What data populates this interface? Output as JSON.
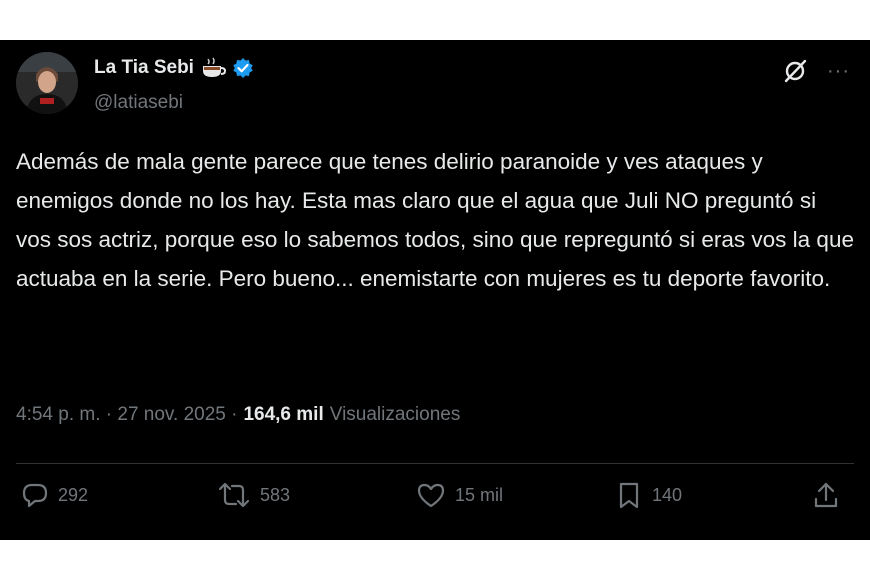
{
  "author": {
    "name": "La Tia Sebi",
    "emoji": "☕",
    "handle": "@latiasebi"
  },
  "tweet": {
    "text": "Además de mala gente parece que tenes  delirio paranoide y ves ataques y enemigos donde no los hay. Esta mas claro que el agua que Juli NO preguntó si vos sos actriz, porque eso lo sabemos todos, sino que repreguntó si eras vos la que actuaba en la serie.  Pero bueno... enemistarte con mujeres es tu deporte favorito.",
    "time": "4:54 p. m. · 27 nov. 2025 ·",
    "views_count": "164,6 mil",
    "views_label": "Visualizaciones"
  },
  "actions": {
    "replies": "292",
    "reposts": "583",
    "likes": "15 mil",
    "bookmarks": "140"
  },
  "colors": {
    "background": "#000000",
    "text": "#e7e9ea",
    "muted": "#71767b",
    "verified": "#1d9bf0",
    "divider": "#2f3336"
  },
  "icons": [
    "avatar",
    "coffee-emoji-icon",
    "verified-badge-icon",
    "grok-icon",
    "more-icon",
    "reply-icon",
    "repost-icon",
    "like-icon",
    "bookmark-icon",
    "share-icon"
  ]
}
